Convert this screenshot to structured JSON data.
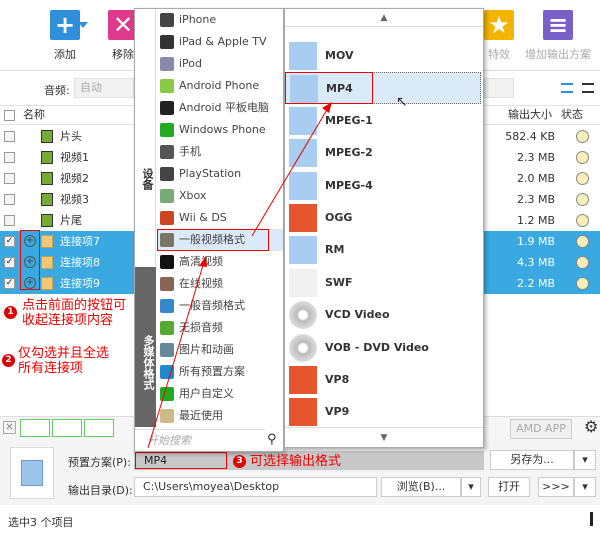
{
  "toolbar": {
    "add": "添加",
    "remove": "移除",
    "effects": "特效",
    "add_output": "增加输出方案"
  },
  "audio": {
    "label": "音频:",
    "value": "自动"
  },
  "columns": {
    "name": "名称",
    "output_size": "输出大小",
    "status": "状态"
  },
  "files": [
    {
      "name": "片头",
      "size": "582.4 KB",
      "checked": false,
      "selected": false
    },
    {
      "name": "视频1",
      "size": "2.3 MB",
      "checked": false,
      "selected": false
    },
    {
      "name": "视频2",
      "size": "2.0 MB",
      "checked": false,
      "selected": false
    },
    {
      "name": "视频3",
      "size": "2.3 MB",
      "checked": false,
      "selected": false
    },
    {
      "name": "片尾",
      "size": "1.2 MB",
      "checked": false,
      "selected": false
    },
    {
      "name": "连接项7",
      "size": "1.9 MB",
      "checked": true,
      "selected": true
    },
    {
      "name": "连接项8",
      "size": "4.3 MB",
      "checked": true,
      "selected": true
    },
    {
      "name": "连接项9",
      "size": "2.2 MB",
      "checked": true,
      "selected": true
    }
  ],
  "popup": {
    "tab_devices": "设备",
    "tab_media": "多媒体格式",
    "categories": [
      "iPhone",
      "iPad & Apple TV",
      "iPod",
      "Android Phone",
      "Android 平板电脑",
      "Windows Phone",
      "手机",
      "PlayStation",
      "Xbox",
      "Wii & DS",
      "一般视频格式",
      "高清视频",
      "在线视频",
      "一般音频格式",
      "无损音频",
      "图片和动画",
      "所有预置方案",
      "用户自定义",
      "最近使用"
    ],
    "selected_category": "一般视频格式",
    "search_placeholder": "开始搜索",
    "formats": [
      "MOV",
      "MP4",
      "MPEG-1",
      "MPEG-2",
      "MPEG-4",
      "OGG",
      "RM",
      "SWF",
      "VCD Video",
      "VOB - DVD Video",
      "VP8",
      "VP9"
    ],
    "selected_format": "MP4"
  },
  "annotations": {
    "a1_line1": "点击前面的按钮可",
    "a1_line2": "收起连接项内容",
    "a2_line1": "仅勾选并且全选",
    "a2_line2": "所有连接项",
    "a3": "可选择输出格式",
    "n1": "1",
    "n2": "2",
    "n3": "3"
  },
  "bottom": {
    "amd": "AMD APP",
    "preset_label": "预置方案(P):",
    "preset_value": "MP4",
    "save_as": "另存为...",
    "output_label": "输出目录(D):",
    "output_value": "C:\\Users\\moyea\\Desktop",
    "browse": "浏览(B)...",
    "open": "打开",
    "arrows": ">>>"
  },
  "status": {
    "text": "选中3 个项目"
  },
  "colors": {
    "selection": "#3aa9e2",
    "annotation": "#ee0000"
  }
}
